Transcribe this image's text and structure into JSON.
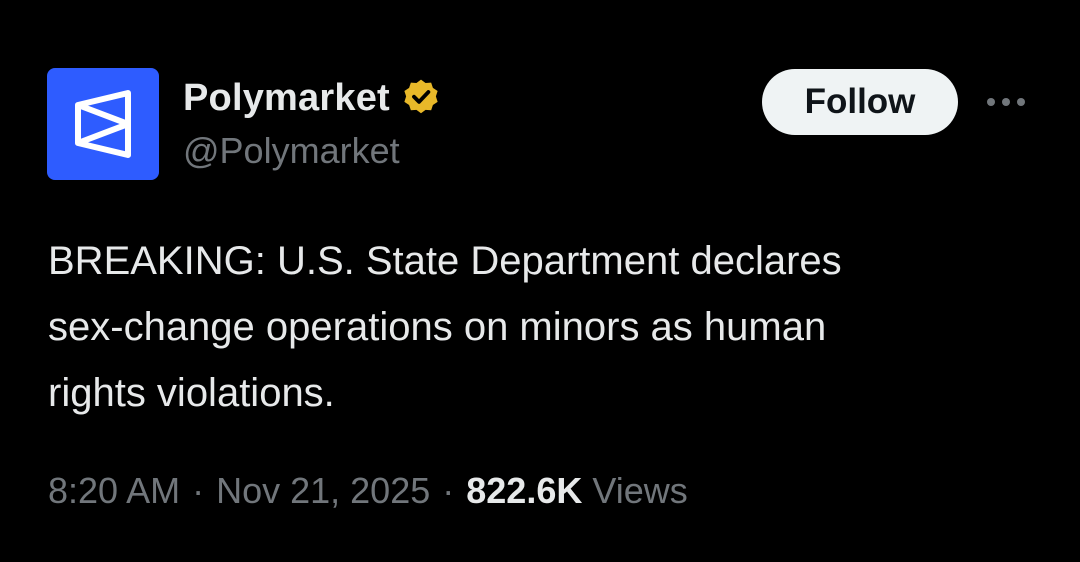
{
  "author": {
    "display_name": "Polymarket",
    "handle": "@Polymarket",
    "verified": true,
    "avatar_icon": "polymarket-logo-icon",
    "avatar_color": "#2e5cff",
    "verified_color": "#e8b829"
  },
  "actions": {
    "follow_label": "Follow",
    "more_icon": "more-dots-icon"
  },
  "tweet": {
    "lines": [
      "BREAKING: U.S. State Department declares",
      "sex-change operations on minors as human",
      "rights violations."
    ]
  },
  "meta": {
    "time": "8:20 AM",
    "separator": "·",
    "date": "Nov 21, 2025",
    "views_count": "822.6K",
    "views_label": "Views"
  }
}
